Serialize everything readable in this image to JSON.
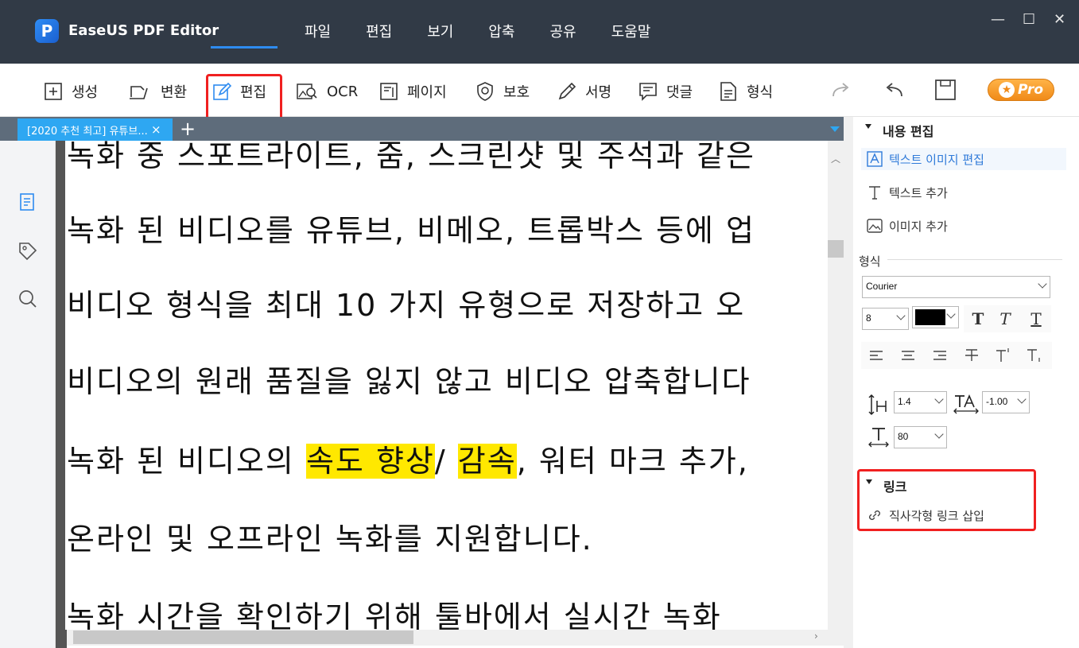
{
  "app": {
    "name": "EaseUS PDF Editor",
    "logo_letter": "P"
  },
  "menu": [
    "파일",
    "편집",
    "보기",
    "압축",
    "공유",
    "도움말"
  ],
  "window_controls": {
    "minimize": "—",
    "maximize": "☐",
    "close": "✕"
  },
  "toolbar": {
    "items": [
      {
        "label": "생성",
        "icon": "plus-square-icon"
      },
      {
        "label": "변환",
        "icon": "convert-icon"
      },
      {
        "label": "편집",
        "icon": "pencil-edit-icon",
        "active": true
      },
      {
        "label": "OCR",
        "icon": "ocr-scan-icon"
      },
      {
        "label": "페이지",
        "icon": "page-icon"
      },
      {
        "label": "보호",
        "icon": "shield-icon"
      },
      {
        "label": "서명",
        "icon": "pen-sign-icon"
      },
      {
        "label": "댓글",
        "icon": "comment-icon"
      },
      {
        "label": "형식",
        "icon": "form-icon"
      }
    ],
    "pro_label": "Pro",
    "accent": "#2e8bf0",
    "highlight_box_color": "#f02020"
  },
  "tabs": {
    "items": [
      {
        "label": "[2020 추천 최고] 유튜브..."
      }
    ],
    "close": "×",
    "add": "+"
  },
  "document": {
    "lines": [
      {
        "segments": [
          {
            "text": "녹화 중 스포트라이트, 줌, 스크린샷 및 주석과 같은"
          }
        ]
      },
      {
        "segments": [
          {
            "text": "녹화 된 비디오를 유튜브, 비메오, 트롭박스 등에 업"
          }
        ]
      },
      {
        "segments": [
          {
            "text": "비디오 형식을 최대 10 가지 유형으로 저장하고 오"
          }
        ]
      },
      {
        "segments": [
          {
            "text": "비디오의 원래 품질을 잃지 않고 비디오 압축합니다"
          }
        ]
      },
      {
        "segments": [
          {
            "text": "녹화 된 비디오의 "
          },
          {
            "text": "속도 향상",
            "highlight": true
          },
          {
            "text": "/ "
          },
          {
            "text": "감속",
            "highlight": true
          },
          {
            "text": ", 워터 마크 추가,"
          }
        ]
      },
      {
        "segments": [
          {
            "text": "온라인 및 오프라인 녹화를 지원합니다."
          }
        ]
      },
      {
        "segments": [
          {
            "text": "녹화 시간을 확인하기 위해 툴바에서 실시간 녹화"
          }
        ]
      }
    ],
    "highlight_color": "#ffe800"
  },
  "panel": {
    "content_edit": {
      "title": "내용 편집",
      "items": [
        {
          "label": "텍스트 이미지 편집",
          "icon": "text-image-edit-icon",
          "active": true
        },
        {
          "label": "텍스트 추가",
          "icon": "text-add-icon"
        },
        {
          "label": "이미지 추가",
          "icon": "image-add-icon"
        }
      ]
    },
    "format": {
      "title": "형식",
      "font": "Courier",
      "font_size": "8",
      "color": "#000000",
      "line_spacing": "1.4",
      "char_spacing": "-1.00",
      "scale": "80",
      "style_buttons": [
        "bold-t-icon",
        "italic-t-icon",
        "underline-t-icon"
      ],
      "align_buttons": [
        "align-left-icon",
        "align-center-icon",
        "align-right-icon",
        "strikethrough-icon",
        "superscript-icon",
        "subscript-icon"
      ]
    },
    "link": {
      "title": "링크",
      "items": [
        {
          "label": "직사각형 링크 삽입",
          "icon": "link-icon"
        }
      ]
    }
  }
}
